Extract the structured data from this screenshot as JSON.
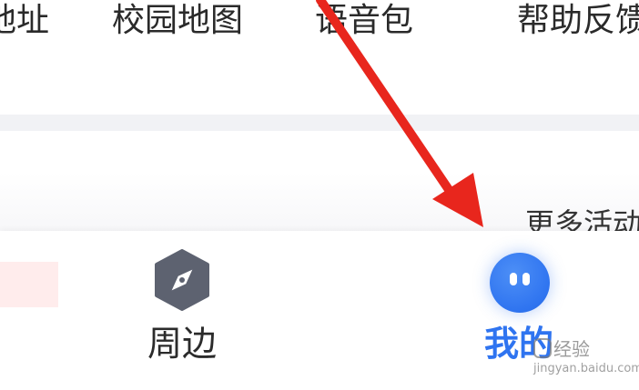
{
  "top_menu": {
    "items": [
      {
        "label": "地址"
      },
      {
        "label": "校园地图"
      },
      {
        "label": "语音包"
      },
      {
        "label": "帮助反馈"
      }
    ]
  },
  "content": {
    "more_link": "更多活动"
  },
  "tab_bar": {
    "tabs": [
      {
        "label": "周边",
        "icon": "compass-icon",
        "active": false
      },
      {
        "label": "我的",
        "icon": "profile-face-icon",
        "active": true
      }
    ],
    "active_color": "#2f74f0"
  },
  "annotation": {
    "arrow_color": "#e8261d",
    "icon": "red-arrow-icon"
  },
  "watermark": {
    "text": "经验",
    "subtext": "jingyan.baidu.com"
  }
}
